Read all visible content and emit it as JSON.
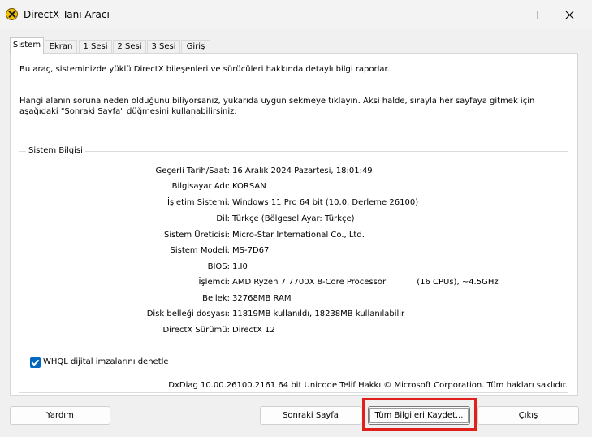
{
  "window": {
    "title": "DirectX Tanı Aracı",
    "icon": "directx-icon"
  },
  "tabs": [
    {
      "label": "Sistem",
      "active": true
    },
    {
      "label": "Ekran",
      "active": false
    },
    {
      "label": "1 Sesi",
      "active": false
    },
    {
      "label": "2 Sesi",
      "active": false
    },
    {
      "label": "3 Sesi",
      "active": false
    },
    {
      "label": "Giriş",
      "active": false
    }
  ],
  "intro": {
    "line1": "Bu araç, sisteminizde yüklü DirectX bileşenleri ve sürücüleri hakkında detaylı bilgi raporlar.",
    "line2": "Hangi alanın soruna neden olduğunu biliyorsanız, yukarıda uygun sekmeye tıklayın. Aksi halde, sırayla her sayfaya gitmek için aşağıdaki \"Sonraki Sayfa\" düğmesini kullanabilirsiniz."
  },
  "system_info": {
    "group_title": "Sistem Bilgisi",
    "rows": [
      {
        "label": "Geçerli Tarih/Saat:",
        "value": "16 Aralık 2024 Pazartesi, 18:01:49"
      },
      {
        "label": "Bilgisayar Adı:",
        "value": "KORSAN"
      },
      {
        "label": "İşletim Sistemi:",
        "value": "Windows 11 Pro 64 bit (10.0, Derleme 26100)"
      },
      {
        "label": "Dil:",
        "value": "Türkçe (Bölgesel Ayar: Türkçe)"
      },
      {
        "label": "Sistem Üreticisi:",
        "value": "Micro-Star International Co., Ltd."
      },
      {
        "label": "Sistem Modeli:",
        "value": "MS-7D67"
      },
      {
        "label": "BIOS:",
        "value": "1.I0"
      },
      {
        "label": "İşlemci:",
        "value": "AMD Ryzen 7 7700X 8-Core Processor            (16 CPUs), ~4.5GHz"
      },
      {
        "label": "Bellek:",
        "value": "32768MB RAM"
      },
      {
        "label": "Disk belleği dosyası:",
        "value": "11819MB kullanıldı, 18238MB kullanılabilir"
      },
      {
        "label": "DirectX Sürümü:",
        "value": "DirectX 12"
      }
    ]
  },
  "whql_checkbox": {
    "label": "WHQL dijital imzalarını denetle",
    "checked": true
  },
  "footer_text": "DxDiag 10.00.26100.2161 64 bit Unicode  Telif Hakkı © Microsoft Corporation. Tüm hakları saklıdır.",
  "buttons": {
    "help": "Yardım",
    "next_page": "Sonraki Sayfa",
    "save_all": "Tüm Bilgileri Kaydet...",
    "exit": "Çıkış"
  },
  "highlight_color": "#e0201b",
  "accent_color": "#0067c0"
}
